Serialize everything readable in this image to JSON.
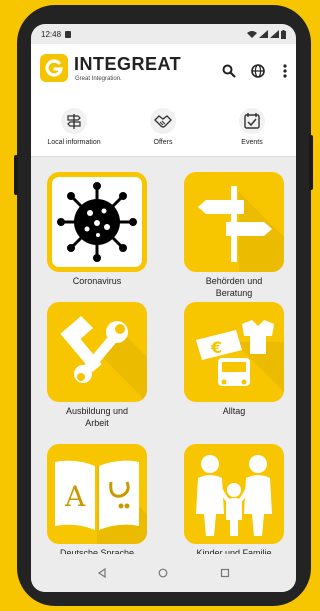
{
  "status": {
    "time": "12:48"
  },
  "brand": {
    "title": "INTEGREAT",
    "subtitle": "Great Integration."
  },
  "tabs": [
    {
      "label": "Local information",
      "icon": "signpost-icon"
    },
    {
      "label": "Offers",
      "icon": "handshake-icon"
    },
    {
      "label": "Events",
      "icon": "calendar-check-icon"
    }
  ],
  "tiles": [
    {
      "label": "Coronavirus",
      "icon": "virus-icon"
    },
    {
      "label": "Behörden und Beratung",
      "icon": "signpost-icon"
    },
    {
      "label": "Ausbildung und Arbeit",
      "icon": "tools-icon"
    },
    {
      "label": "Alltag",
      "icon": "daily-life-icon"
    },
    {
      "label": "Deutsche Sprache",
      "icon": "book-icon"
    },
    {
      "label": "Kinder und Familie",
      "icon": "family-icon"
    }
  ],
  "colors": {
    "accent": "#f7c600",
    "frame": "#232323",
    "screen_bg": "#ececec"
  }
}
